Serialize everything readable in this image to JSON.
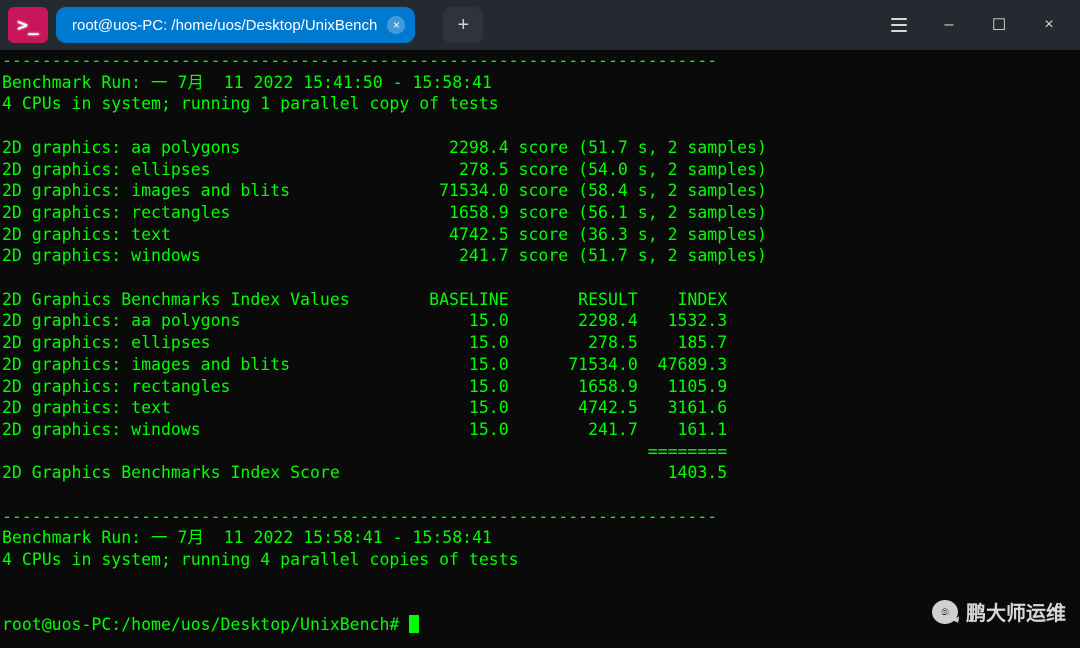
{
  "window": {
    "tab_title": "root@uos-PC: /home/uos/Desktop/UnixBench",
    "new_tab_glyph": "+",
    "close_glyph": "×",
    "min_glyph": "–",
    "max_glyph": "☐",
    "x_glyph": "×"
  },
  "watermark_text": "鹏大师运维",
  "terminal": {
    "dash_line": "------------------------------------------------------------------------",
    "run1_header": "Benchmark Run: 一 7月  11 2022 15:41:50 - 15:58:41",
    "run1_cpus": "4 CPUs in system; running 1 parallel copy of tests",
    "scores": [
      {
        "name": "2D graphics: aa polygons",
        "score": "2298.4",
        "time": "51.7",
        "samples": "2"
      },
      {
        "name": "2D graphics: ellipses",
        "score": "278.5",
        "time": "54.0",
        "samples": "2"
      },
      {
        "name": "2D graphics: images and blits",
        "score": "71534.0",
        "time": "58.4",
        "samples": "2"
      },
      {
        "name": "2D graphics: rectangles",
        "score": "1658.9",
        "time": "56.1",
        "samples": "2"
      },
      {
        "name": "2D graphics: text",
        "score": "4742.5",
        "time": "36.3",
        "samples": "2"
      },
      {
        "name": "2D graphics: windows",
        "score": "241.7",
        "time": "51.7",
        "samples": "2"
      }
    ],
    "index_title": "2D Graphics Benchmarks Index Values",
    "index_cols": {
      "c1": "BASELINE",
      "c2": "RESULT",
      "c3": "INDEX"
    },
    "index_rows": [
      {
        "name": "2D graphics: aa polygons",
        "baseline": "15.0",
        "result": "2298.4",
        "index": "1532.3"
      },
      {
        "name": "2D graphics: ellipses",
        "baseline": "15.0",
        "result": "278.5",
        "index": "185.7"
      },
      {
        "name": "2D graphics: images and blits",
        "baseline": "15.0",
        "result": "71534.0",
        "index": "47689.3"
      },
      {
        "name": "2D graphics: rectangles",
        "baseline": "15.0",
        "result": "1658.9",
        "index": "1105.9"
      },
      {
        "name": "2D graphics: text",
        "baseline": "15.0",
        "result": "4742.5",
        "index": "3161.6"
      },
      {
        "name": "2D graphics: windows",
        "baseline": "15.0",
        "result": "241.7",
        "index": "161.1"
      }
    ],
    "equals": "========",
    "index_score_label": "2D Graphics Benchmarks Index Score",
    "index_score_value": "1403.5",
    "run2_header": "Benchmark Run: 一 7月  11 2022 15:58:41 - 15:58:41",
    "run2_cpus": "4 CPUs in system; running 4 parallel copies of tests",
    "prompt": "root@uos-PC:/home/uos/Desktop/UnixBench# "
  }
}
